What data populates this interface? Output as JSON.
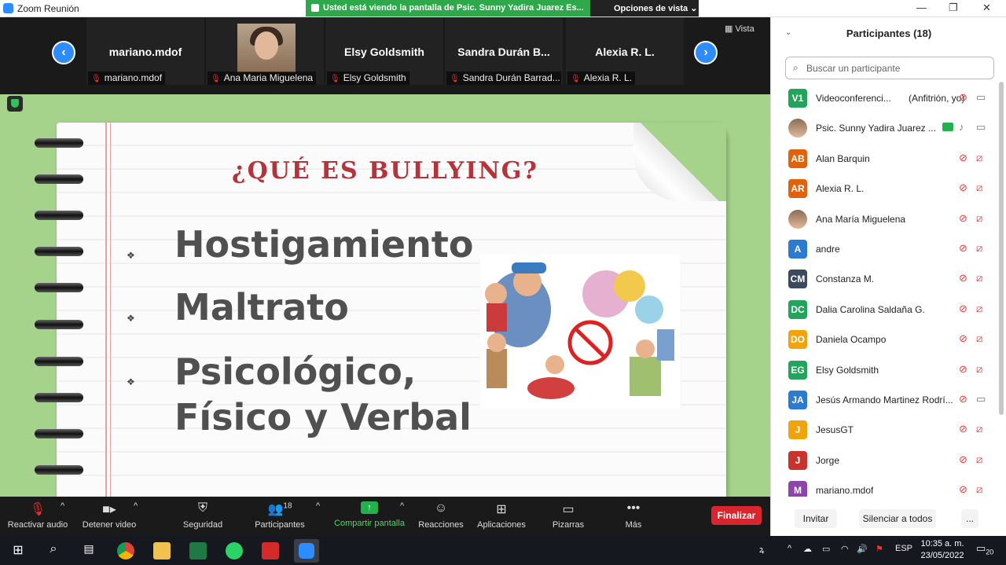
{
  "window": {
    "title": "Zoom Reunión",
    "share_banner": "Usted está viendo la pantalla de Psic.  Sunny Yadira Juarez  Es...",
    "view_options": "Opciones de vista",
    "vista": "Vista"
  },
  "gallery": {
    "tiles": [
      {
        "name": "mariano.mdof",
        "label": "mariano.mdof"
      },
      {
        "name": "",
        "label": "Ana Maria Miguelena"
      },
      {
        "name": "Elsy Goldsmith",
        "label": "Elsy Goldsmith"
      },
      {
        "name": "Sandra  Durán  B...",
        "label": "Sandra Durán Barrad..."
      },
      {
        "name": "Alexia R. L.",
        "label": "Alexia R. L."
      }
    ]
  },
  "slide": {
    "title": "¿QUÉ ES BULLYING?",
    "items": [
      "Hostigamiento",
      "Maltrato",
      "Psicológico,",
      "Físico y Verbal"
    ],
    "bullet": "❖"
  },
  "toolbar": {
    "audio": "Reactivar audio",
    "video": "Detener video",
    "security": "Seguridad",
    "participants": "Participantes",
    "participants_count": "18",
    "share": "Compartir pantalla",
    "reactions": "Reacciones",
    "apps": "Aplicaciones",
    "whiteboards": "Pizarras",
    "more": "Más",
    "end": "Finalizar"
  },
  "panel": {
    "title": "Participantes (18)",
    "search_placeholder": "Buscar un participante",
    "participants": [
      {
        "initials": "V1",
        "name": "Videoconferenci...",
        "role": "(Anfitrión, yo)",
        "color": "#22a45d"
      },
      {
        "initials": "",
        "name": "Psic.  Sunny Yadira Juarez  ...",
        "color": ""
      },
      {
        "initials": "AB",
        "name": "Alan Barquin",
        "color": "#e0620d"
      },
      {
        "initials": "AR",
        "name": "Alexia R. L.",
        "color": "#e0620d"
      },
      {
        "initials": "",
        "name": "Ana María Miguelena",
        "color": ""
      },
      {
        "initials": "A",
        "name": "andre",
        "color": "#2d7bd0"
      },
      {
        "initials": "CM",
        "name": "Constanza M.",
        "color": "#3b4a5c"
      },
      {
        "initials": "DC",
        "name": "Dalia Carolina Saldaña G.",
        "color": "#22a45d"
      },
      {
        "initials": "DO",
        "name": "Daniela Ocampo",
        "color": "#f0a30a"
      },
      {
        "initials": "EG",
        "name": "Elsy Goldsmith",
        "color": "#22a45d"
      },
      {
        "initials": "JA",
        "name": "Jesús Armando Martinez Rodrí...",
        "color": "#2d7bd0"
      },
      {
        "initials": "J",
        "name": "JesusGT",
        "color": "#f0a30a"
      },
      {
        "initials": "J",
        "name": "Jorge",
        "color": "#c8342b"
      },
      {
        "initials": "M",
        "name": "mariano.mdof",
        "color": "#8e44ad"
      }
    ],
    "invite": "Invitar",
    "mute_all": "Silenciar a todos",
    "more": "..."
  },
  "taskbar": {
    "lang": "ESP",
    "time": "10:35 a. m.",
    "date": "23/05/2022",
    "notif": "20"
  }
}
